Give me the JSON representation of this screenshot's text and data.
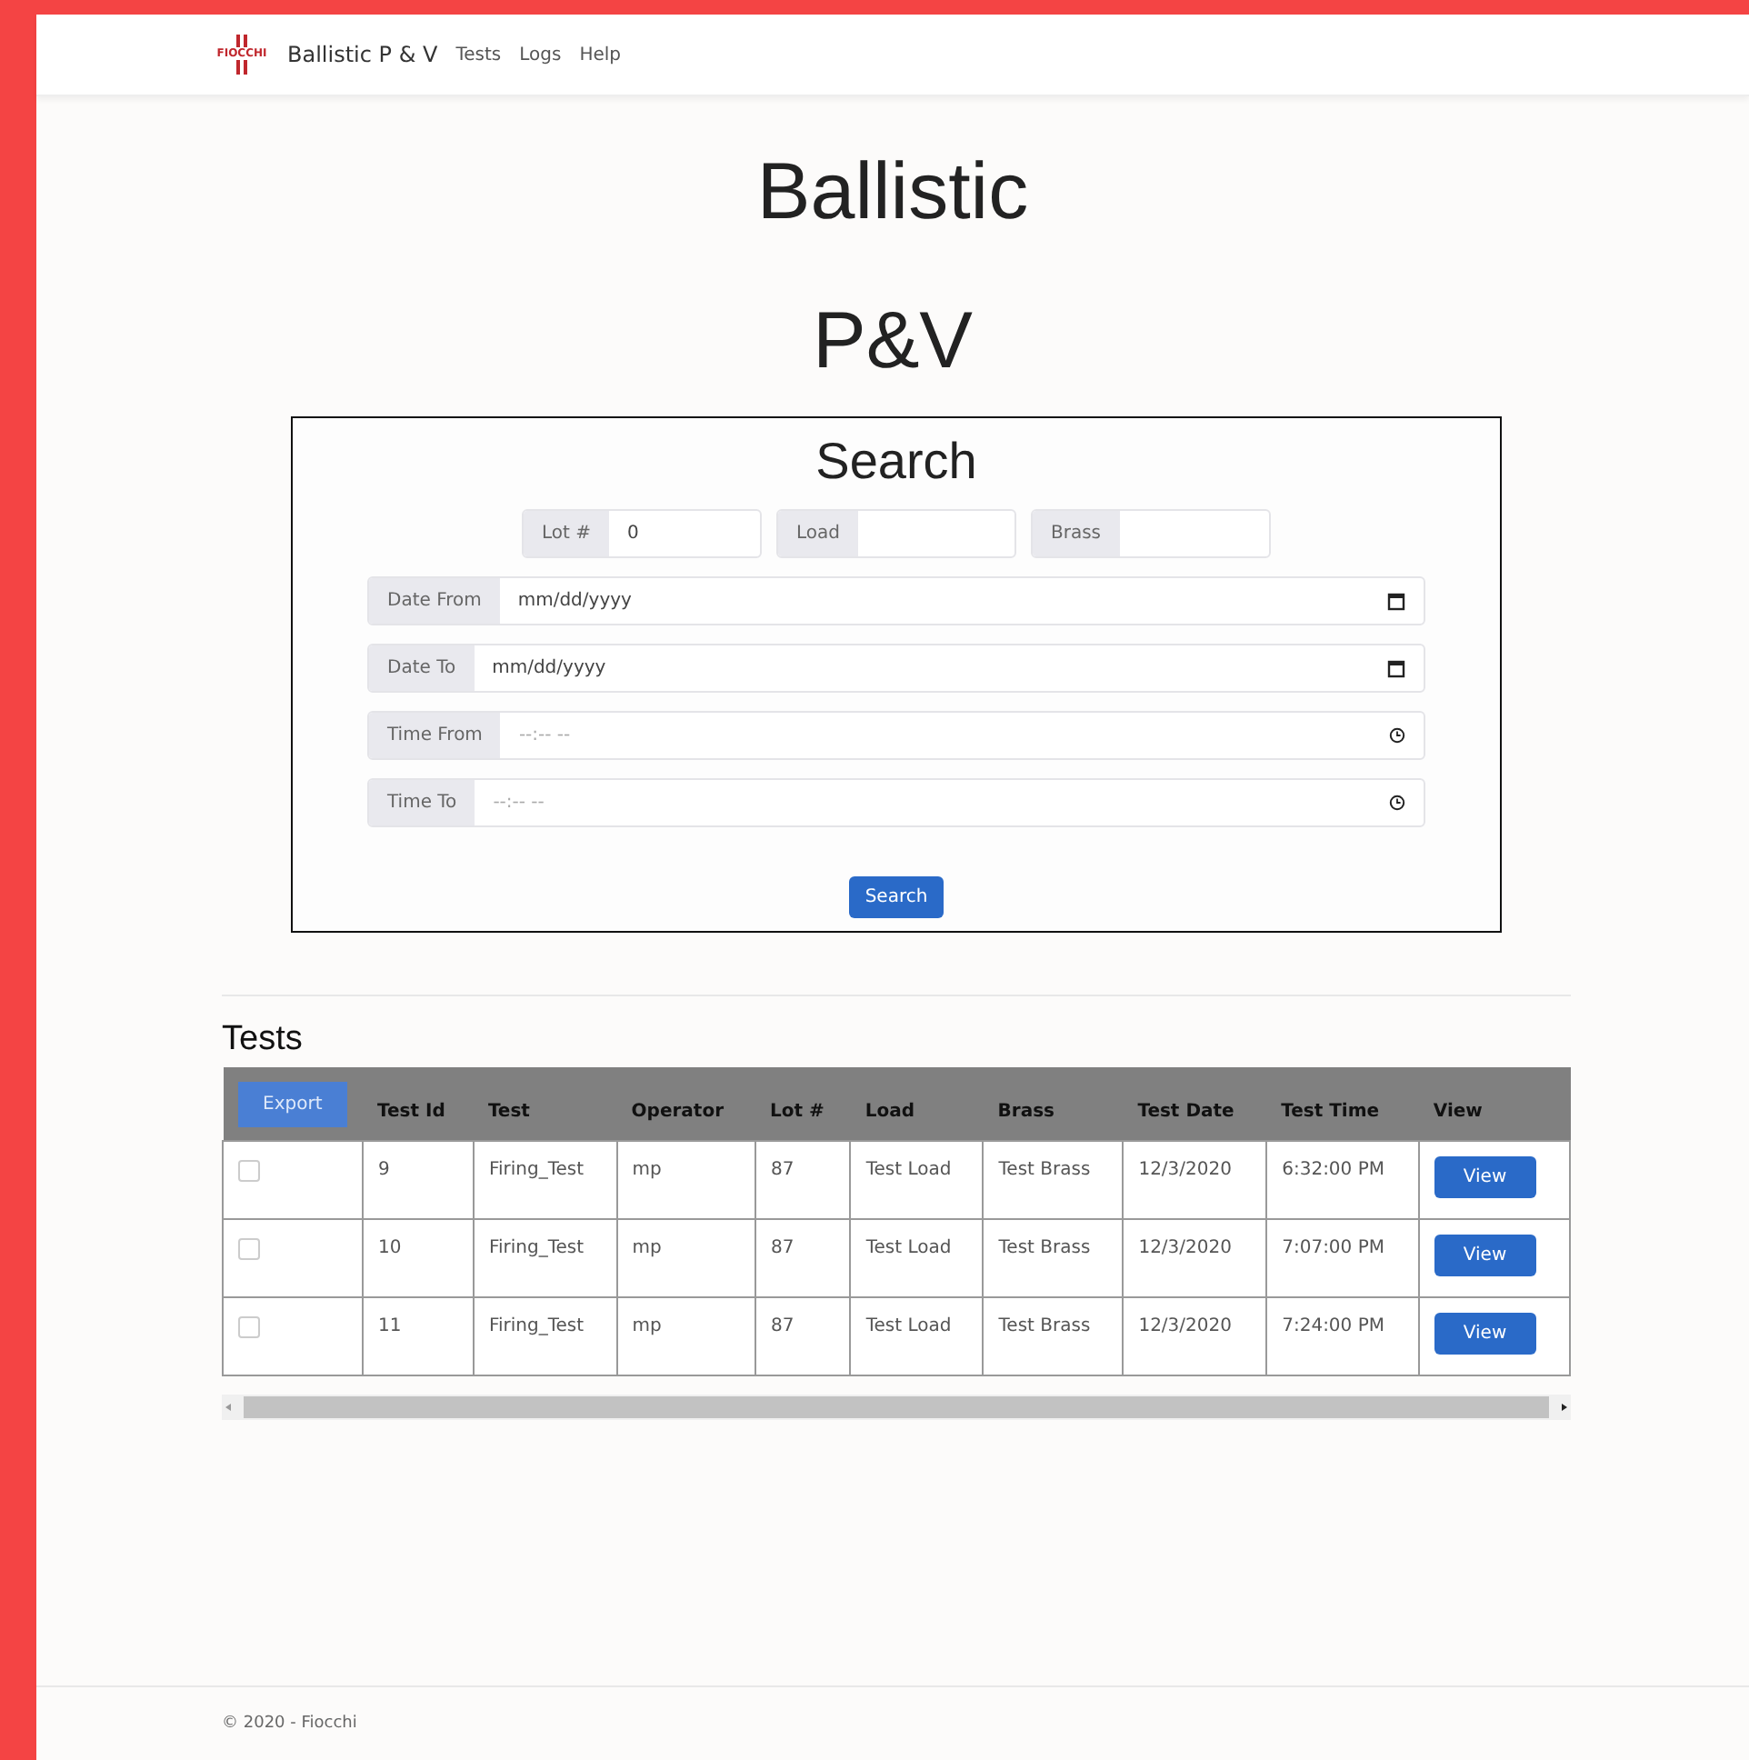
{
  "navbar": {
    "logo_text": "FIOCCHI",
    "brand": "Ballistic P & V",
    "links": [
      "Tests",
      "Logs",
      "Help"
    ]
  },
  "title_lines": [
    "Ballistic",
    "P&V"
  ],
  "search": {
    "title": "Search",
    "short_fields": [
      {
        "label": "Lot #",
        "value": "0"
      },
      {
        "label": "Load"
      },
      {
        "label": "Brass"
      }
    ],
    "long_fields": [
      {
        "label": "Date From",
        "kind": "date",
        "placeholder": "mm/dd/yyyy"
      },
      {
        "label": "Date To",
        "kind": "date",
        "placeholder": "mm/dd/yyyy"
      },
      {
        "label": "Time From",
        "kind": "time",
        "placeholder": "--:-- --"
      },
      {
        "label": "Time To",
        "kind": "time",
        "placeholder": "--:-- --"
      }
    ],
    "button": "Search"
  },
  "tests": {
    "title": "Tests",
    "export_button": "Export",
    "columns": [
      "Test Id",
      "Test",
      "Operator",
      "Lot #",
      "Load",
      "Brass",
      "Test Date",
      "Test Time",
      "View"
    ],
    "rows": [
      {
        "checked": false,
        "cells": [
          "9",
          "Firing_Test",
          "mp",
          "87",
          "Test Load",
          "Test Brass",
          "12/3/2020",
          "6:32:00 PM"
        ],
        "button": "View"
      },
      {
        "checked": false,
        "cells": [
          "10",
          "Firing_Test",
          "mp",
          "87",
          "Test Load",
          "Test Brass",
          "12/3/2020",
          "7:07:00 PM"
        ],
        "button": "View"
      },
      {
        "checked": false,
        "cells": [
          "11",
          "Firing_Test",
          "mp",
          "87",
          "Test Load",
          "Test Brass",
          "12/3/2020",
          "7:24:00 PM"
        ],
        "button": "View"
      }
    ]
  },
  "footer": "© 2020 - Fiocchi"
}
